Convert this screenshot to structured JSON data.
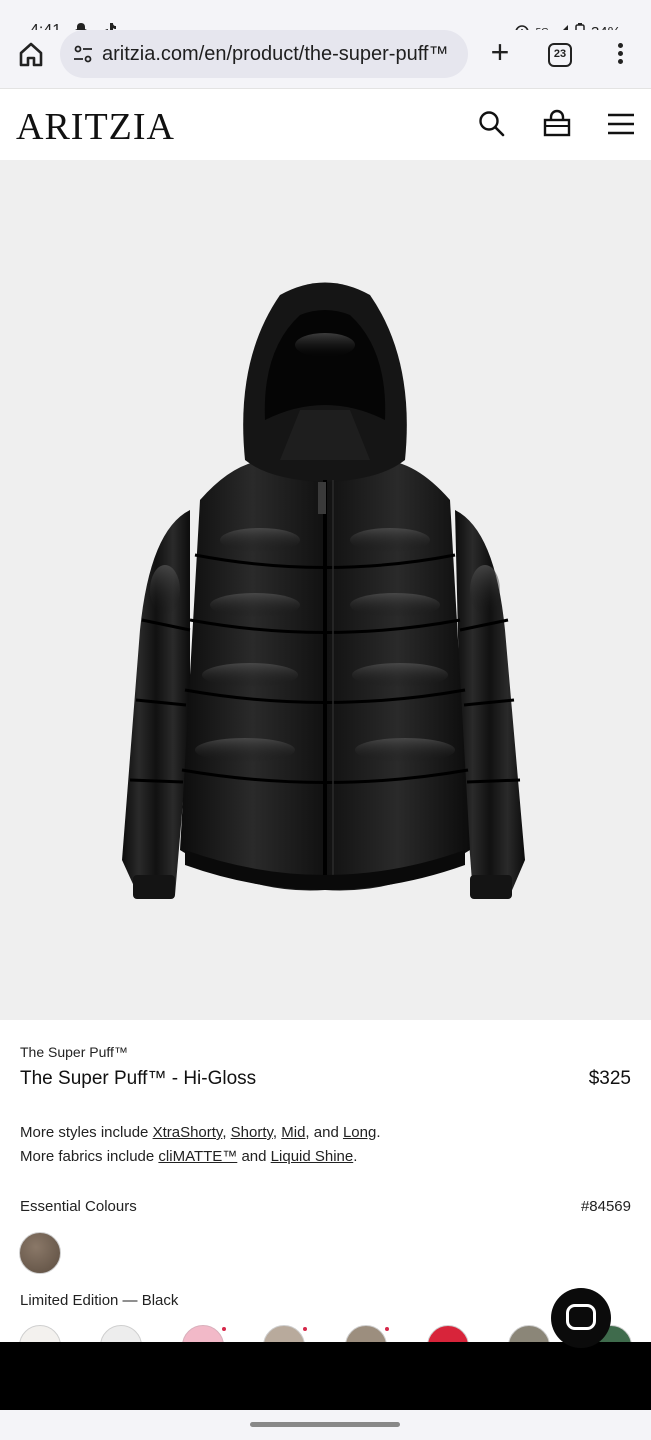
{
  "status_bar": {
    "time": "4:41",
    "network": "5G",
    "battery": "34%"
  },
  "browser": {
    "url": "aritzia.com/en/product/the-super-puff™",
    "tab_count": "23"
  },
  "site": {
    "logo": "ARITZIA"
  },
  "product": {
    "collection": "The Super Puff™",
    "name": "The Super Puff™ - Hi-Gloss",
    "price": "$325",
    "styles_prefix": "More styles include ",
    "styles": [
      "XtraShorty",
      "Shorty",
      "Mid",
      "Long"
    ],
    "styles_sep1": ", ",
    "styles_and": ", and ",
    "styles_end": ".",
    "fabrics_prefix": "More fabrics include ",
    "fabrics": [
      "cliMATTE™",
      "Liquid Shine"
    ],
    "fabrics_and": " and ",
    "fabrics_end": ".",
    "essential_label": "Essential Colours",
    "style_number": "#84569",
    "limited_label": "Limited Edition — Black"
  },
  "colors": {
    "essential_swatch": "#6e5e50",
    "limited_swatches": [
      "#f3f1ee",
      "#ededed",
      "#f2b9c8",
      "#b8aa9c",
      "#9c8e7e",
      "#d8243a",
      "#8b8678",
      "#3f6b4c"
    ]
  }
}
